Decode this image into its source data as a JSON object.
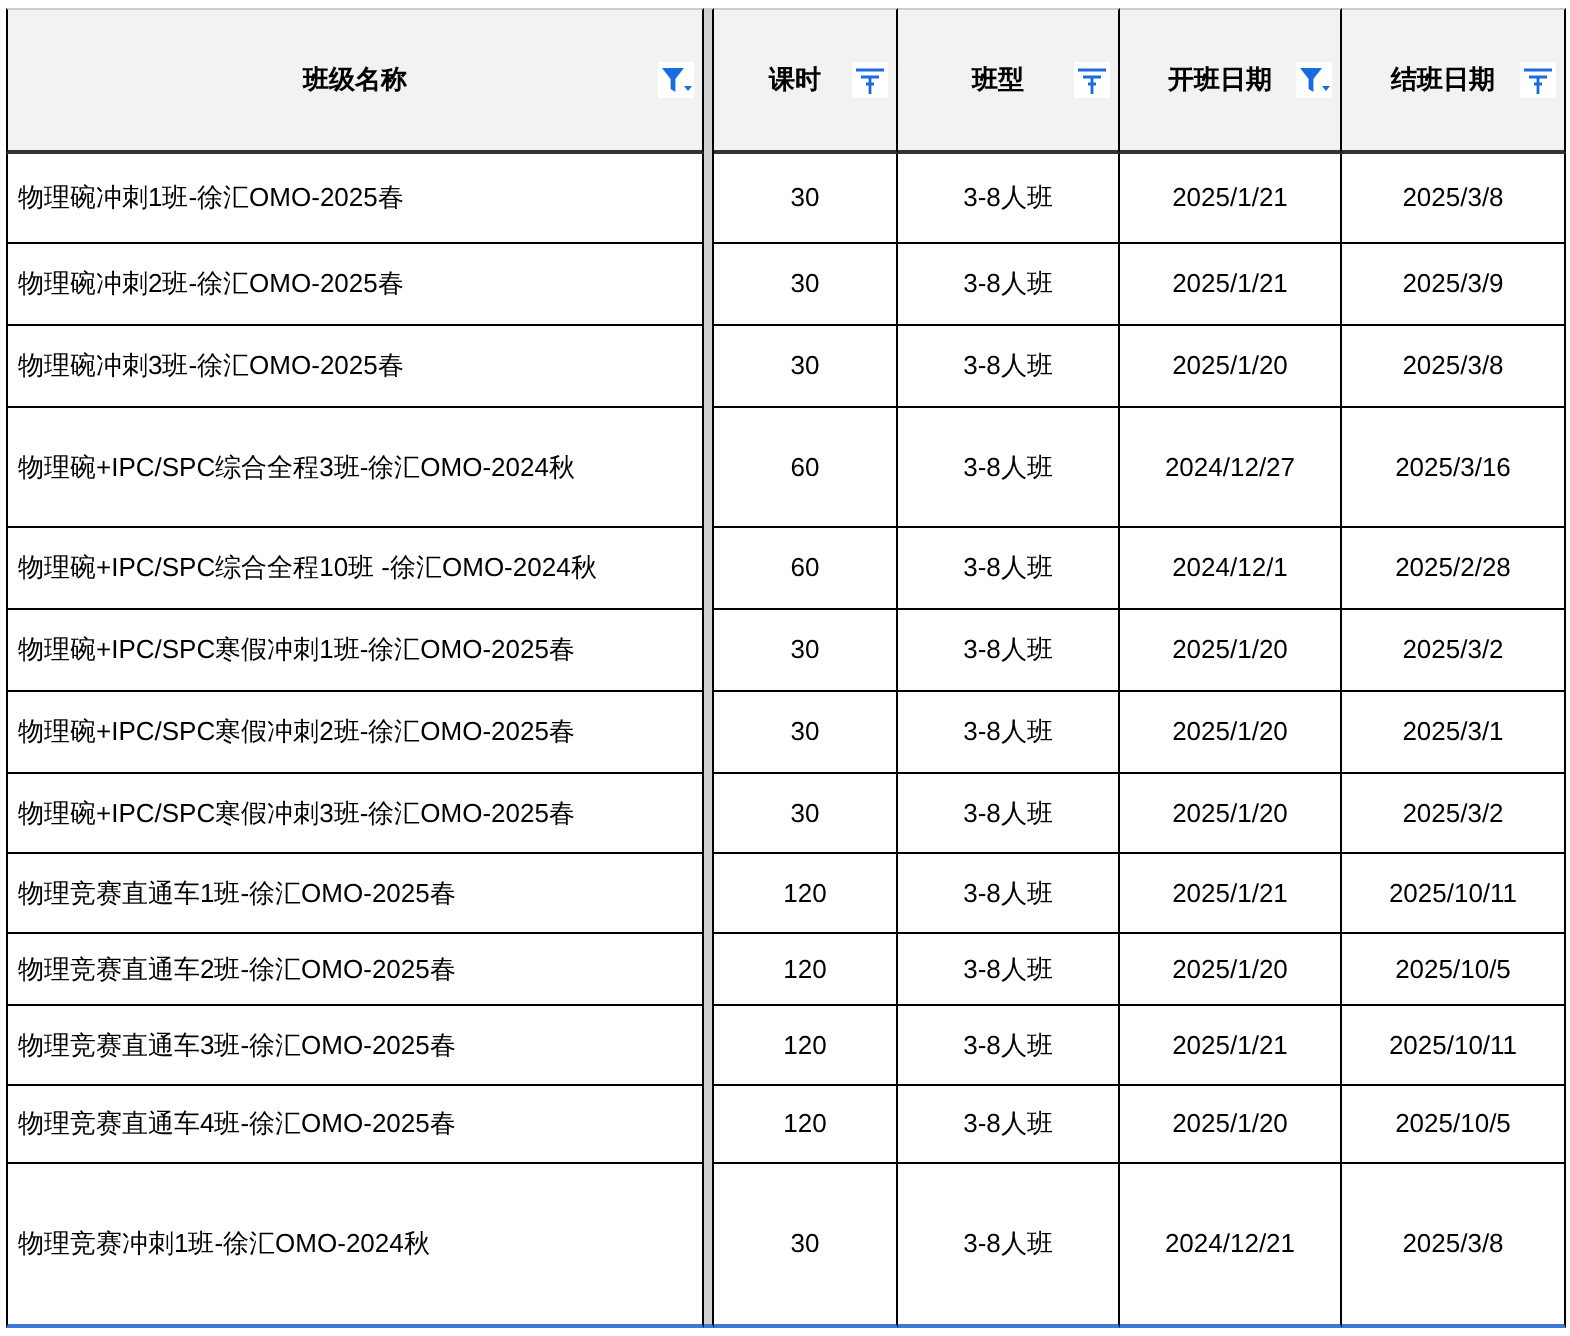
{
  "table": {
    "columns": [
      {
        "label": "班级名称",
        "filtered": true
      },
      {
        "label": "课时",
        "filtered": false
      },
      {
        "label": "班型",
        "filtered": false
      },
      {
        "label": "开班日期",
        "filtered": true
      },
      {
        "label": "结班日期",
        "filtered": false
      }
    ],
    "rows": [
      [
        "物理碗冲刺1班-徐汇OMO-2025春",
        "30",
        "3-8人班",
        "2025/1/21",
        "2025/3/8"
      ],
      [
        "物理碗冲刺2班-徐汇OMO-2025春",
        "30",
        "3-8人班",
        "2025/1/21",
        "2025/3/9"
      ],
      [
        "物理碗冲刺3班-徐汇OMO-2025春",
        "30",
        "3-8人班",
        "2025/1/20",
        "2025/3/8"
      ],
      [
        "物理碗+IPC/SPC综合全程3班-徐汇OMO-2024秋",
        "60",
        "3-8人班",
        "2024/12/27",
        "2025/3/16"
      ],
      [
        "物理碗+IPC/SPC综合全程10班 -徐汇OMO-2024秋",
        "60",
        "3-8人班",
        "2024/12/1",
        "2025/2/28"
      ],
      [
        "物理碗+IPC/SPC寒假冲刺1班-徐汇OMO-2025春",
        "30",
        "3-8人班",
        "2025/1/20",
        "2025/3/2"
      ],
      [
        "物理碗+IPC/SPC寒假冲刺2班-徐汇OMO-2025春",
        "30",
        "3-8人班",
        "2025/1/20",
        "2025/3/1"
      ],
      [
        "物理碗+IPC/SPC寒假冲刺3班-徐汇OMO-2025春",
        "30",
        "3-8人班",
        "2025/1/20",
        "2025/3/2"
      ],
      [
        "物理竞赛直通车1班-徐汇OMO-2025春",
        "120",
        "3-8人班",
        "2025/1/21",
        "2025/10/11"
      ],
      [
        "物理竞赛直通车2班-徐汇OMO-2025春",
        "120",
        "3-8人班",
        "2025/1/20",
        "2025/10/5"
      ],
      [
        "物理竞赛直通车3班-徐汇OMO-2025春",
        "120",
        "3-8人班",
        "2025/1/21",
        "2025/10/11"
      ],
      [
        "物理竞赛直通车4班-徐汇OMO-2025春",
        "120",
        "3-8人班",
        "2025/1/20",
        "2025/10/5"
      ],
      [
        "物理竞赛冲刺1班-徐汇OMO-2024秋",
        "30",
        "3-8人班",
        "2024/12/21",
        "2025/3/8"
      ]
    ]
  }
}
